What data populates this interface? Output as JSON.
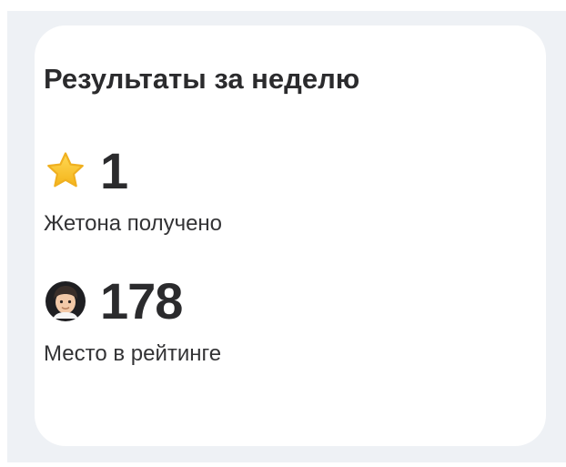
{
  "card": {
    "title": "Результаты за неделю",
    "stats": [
      {
        "icon": "star-icon",
        "value": "1",
        "caption": "Жетона получено"
      },
      {
        "icon": "avatar-icon",
        "value": "178",
        "caption": "Место в рейтинге"
      }
    ]
  },
  "colors": {
    "page_background": "#eef1f5",
    "card_background": "#ffffff",
    "text_primary": "#2b2b2d",
    "star": "#f6c531"
  }
}
